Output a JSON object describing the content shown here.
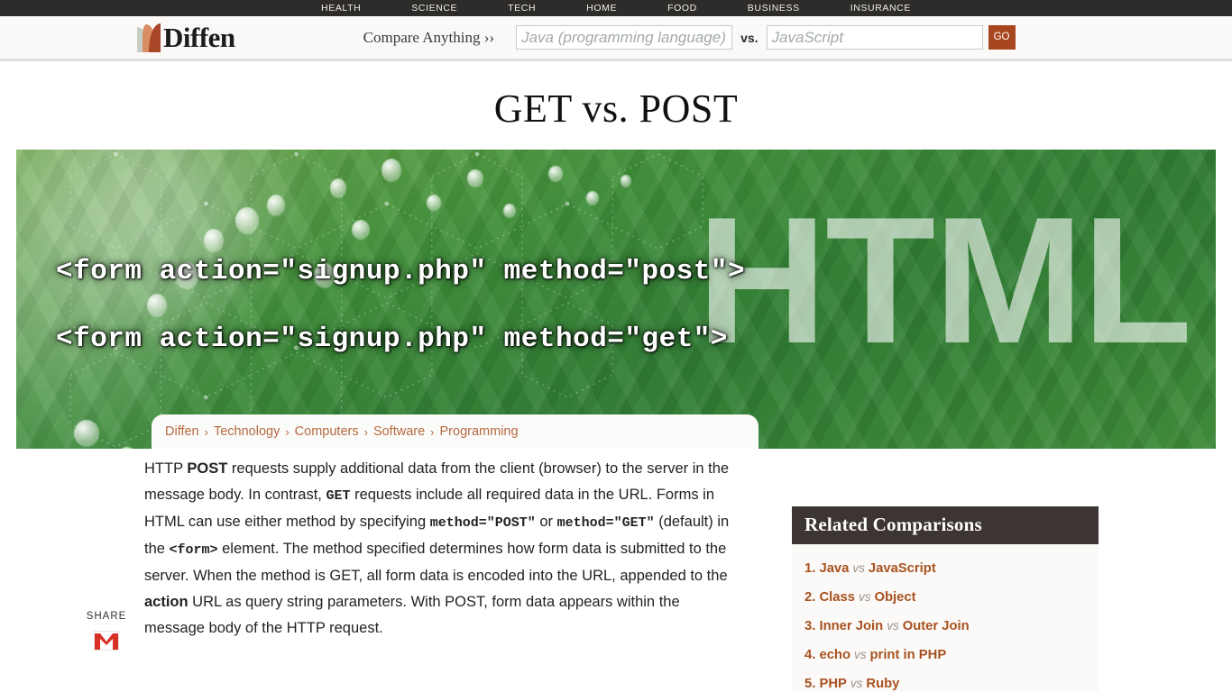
{
  "topnav": {
    "items": [
      {
        "label": "HEALTH"
      },
      {
        "label": "SCIENCE"
      },
      {
        "label": "TECH"
      },
      {
        "label": "HOME"
      },
      {
        "label": "FOOD"
      },
      {
        "label": "BUSINESS"
      },
      {
        "label": "INSURANCE"
      }
    ]
  },
  "header": {
    "logo_text": "Diffen",
    "compare_label": "Compare Anything ››",
    "search": {
      "left_placeholder": "Java (programming language)",
      "left_value": "",
      "right_placeholder": "JavaScript",
      "right_value": "",
      "vs_label": "vs.",
      "go_label": "GO",
      "go_color": "#a8461f"
    }
  },
  "page": {
    "title": "GET vs. POST"
  },
  "hero": {
    "watermark": "HTML",
    "code_lines": [
      "<form action=\"signup.php\" method=\"post\">",
      "<form action=\"signup.php\" method=\"get\">"
    ],
    "background_color": "#3f8f3a"
  },
  "breadcrumb": {
    "items": [
      {
        "label": "Diffen"
      },
      {
        "label": "Technology"
      },
      {
        "label": "Computers"
      },
      {
        "label": "Software"
      },
      {
        "label": "Programming"
      }
    ],
    "separator": "›",
    "link_color": "#b5693e"
  },
  "share": {
    "label": "SHARE",
    "icons": [
      {
        "name": "gmail-icon",
        "title": "Gmail",
        "color": "#d93025"
      }
    ]
  },
  "article": {
    "paragraph": {
      "p1": "HTTP ",
      "b1": "POST",
      "p2": " requests supply additional data from the client (browser) to the server in the message body. In contrast, ",
      "b2": "GET",
      "p3": " requests include all required data in the URL. Forms in HTML can use either method by specifying ",
      "b3": "method=\"POST\"",
      "p4": " or ",
      "b4": "method=\"GET\"",
      "p5": " (default) in the ",
      "b5": "<form>",
      "p6": " element. The method specified determines how form data is submitted to the server. When the method is GET, all form data is encoded into the URL, appended to the ",
      "b6": "action",
      "p7": " URL as query string parameters. With POST, form data appears within the message body of the HTTP request."
    }
  },
  "sidebar": {
    "title": "Related Comparisons",
    "title_bg": "#3d3531",
    "items": [
      {
        "num": "1.",
        "left": "Java",
        "vs": "vs",
        "right": "JavaScript"
      },
      {
        "num": "2.",
        "left": "Class",
        "vs": "vs",
        "right": "Object"
      },
      {
        "num": "3.",
        "left": "Inner Join",
        "vs": "vs",
        "right": "Outer Join"
      },
      {
        "num": "4.",
        "left": "echo",
        "vs": "vs",
        "right": "print in PHP"
      },
      {
        "num": "5.",
        "left": "PHP",
        "vs": "vs",
        "right": "Ruby"
      }
    ]
  }
}
